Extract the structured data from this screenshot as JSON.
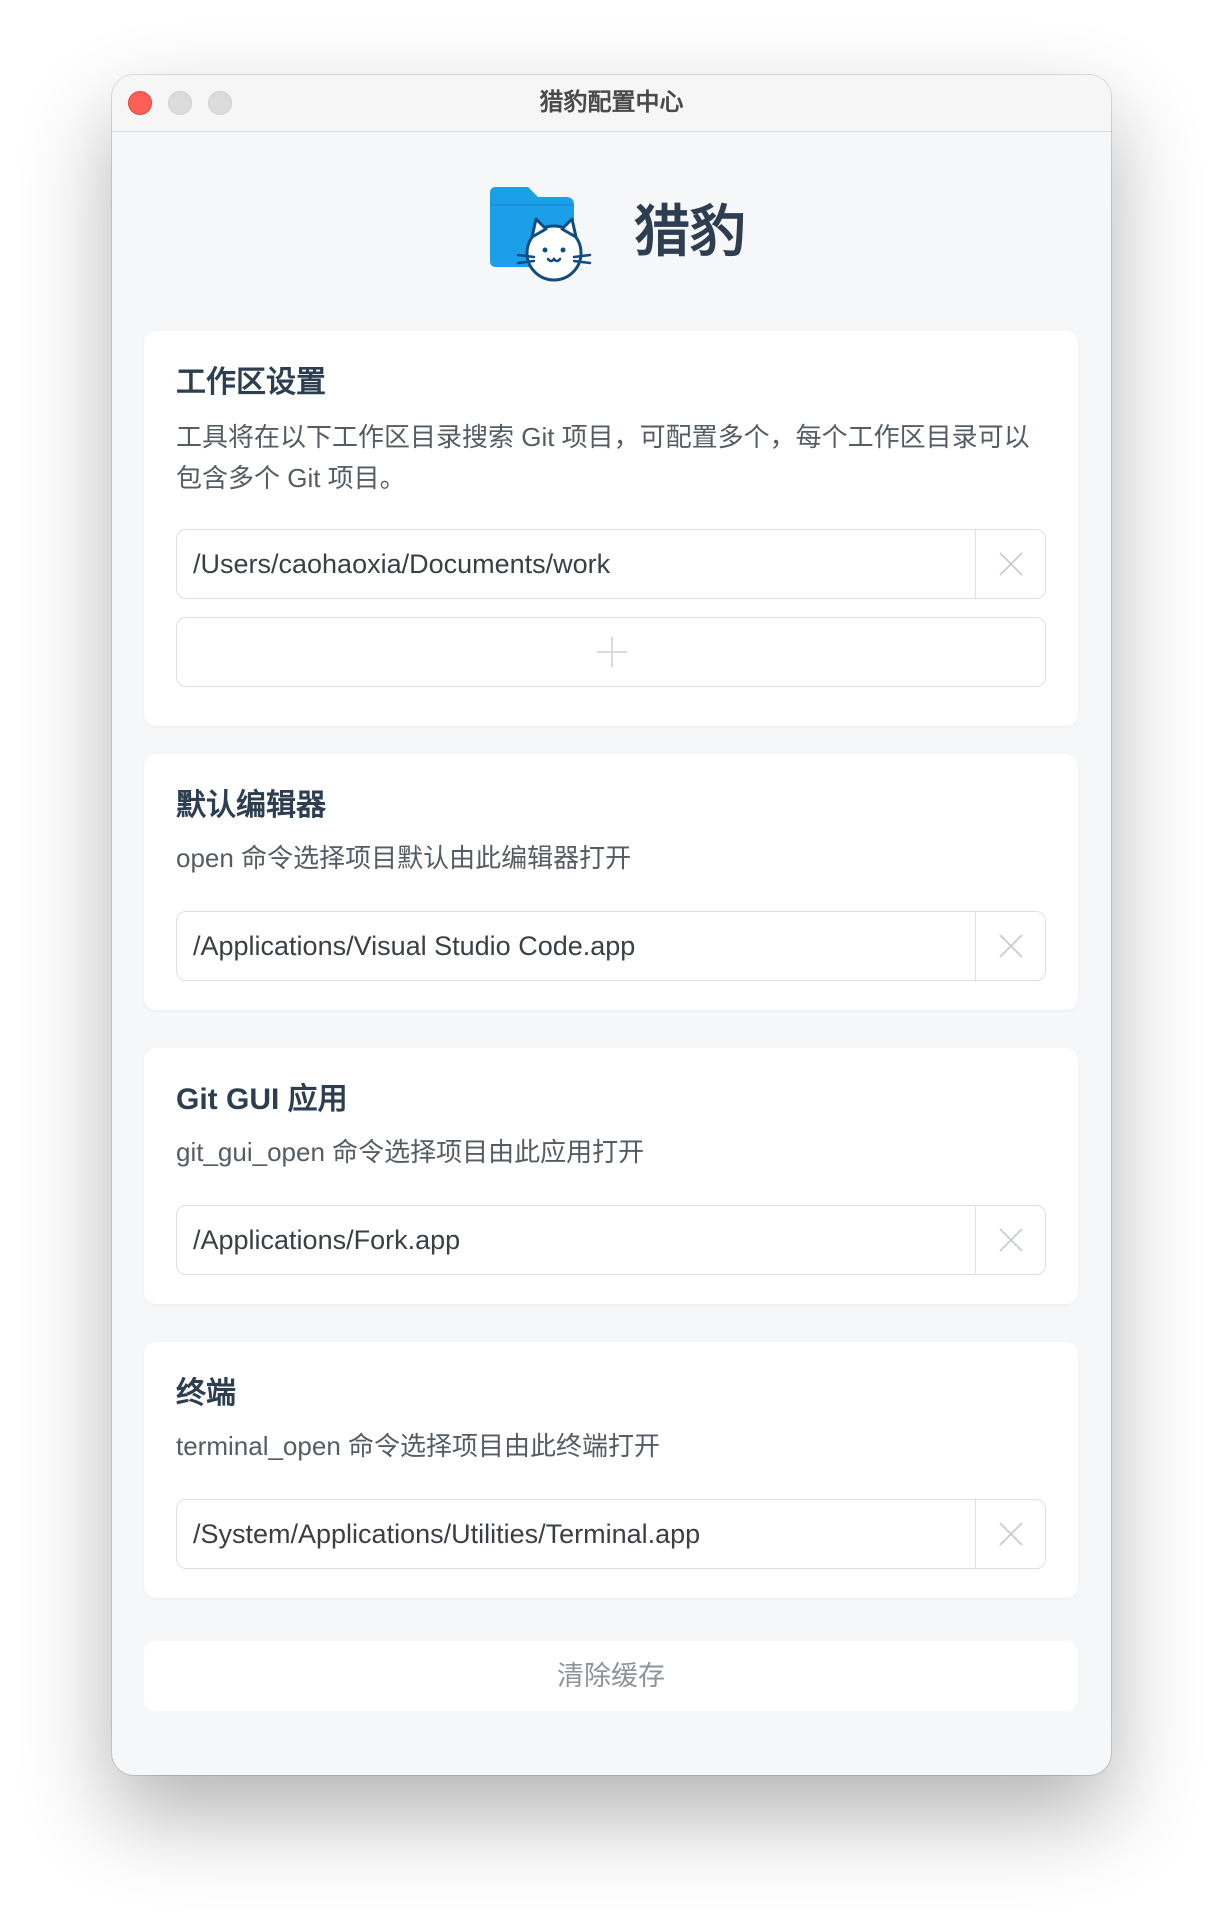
{
  "window": {
    "title": "猎豹配置中心"
  },
  "brand": {
    "name": "猎豹",
    "logo_icon": "folder-cat-icon",
    "logo_color": "#1a9fe8"
  },
  "workspace": {
    "title": "工作区设置",
    "description": "工具将在以下工作区目录搜索 Git 项目，可配置多个，每个工作区目录可以包含多个 Git 项目。",
    "paths": [
      {
        "value": "/Users/caohaoxia/Documents/work"
      }
    ],
    "add_icon": "plus-icon"
  },
  "editor": {
    "title": "默认编辑器",
    "description": "open 命令选择项目默认由此编辑器打开",
    "value": "/Applications/Visual Studio Code.app"
  },
  "git_gui": {
    "title": "Git GUI 应用",
    "description": "git_gui_open 命令选择项目由此应用打开",
    "value": "/Applications/Fork.app"
  },
  "terminal": {
    "title": "终端",
    "description": "terminal_open 命令选择项目由此终端打开",
    "value": "/System/Applications/Utilities/Terminal.app"
  },
  "actions": {
    "clear_cache_label": "清除缓存"
  },
  "colors": {
    "window_bg": "#f6f7f9",
    "heading": "#2c3e50",
    "close_red": "#fe5f57"
  }
}
